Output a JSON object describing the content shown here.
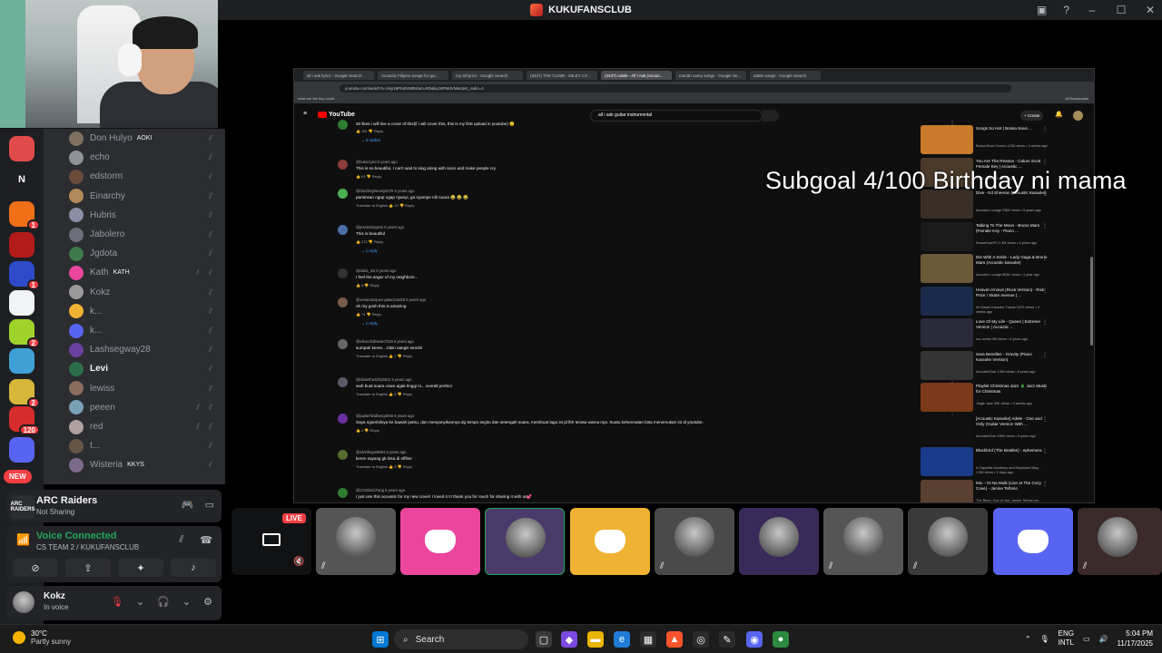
{
  "window": {
    "title": "KUKUFANSCLUB"
  },
  "servers": [
    {
      "badge": "",
      "color": "#e24b4b"
    },
    {
      "badge": "36",
      "color": "#1e1f22",
      "letter": "N"
    },
    {
      "badge": "1",
      "color": "#f0701a"
    },
    {
      "badge": "",
      "color": "#b31b1b"
    },
    {
      "badge": "1",
      "color": "#2f4ac9"
    },
    {
      "badge": "",
      "color": "#f2f3f5"
    },
    {
      "badge": "2",
      "color": "#9fd32b"
    },
    {
      "badge": "",
      "color": "#3fa0d6"
    },
    {
      "badge": "2",
      "color": "#d6b73b"
    },
    {
      "badge": "120",
      "color": "#d62c2c"
    },
    {
      "badge": "",
      "color": "#5865f2"
    }
  ],
  "new_label": "NEW",
  "members": [
    {
      "name": "Don Hulyo",
      "tag": "AOKI",
      "color": "#7f6f5e"
    },
    {
      "name": "echo",
      "tag": "",
      "color": "#8e9297"
    },
    {
      "name": "edstorm",
      "tag": "",
      "color": "#6b4a3a"
    },
    {
      "name": "Einarchy",
      "tag": "",
      "color": "#b08a5a"
    },
    {
      "name": "Hubris",
      "tag": "",
      "color": "#8a8fa6"
    },
    {
      "name": "Jabolero",
      "tag": "",
      "color": "#6d6f78"
    },
    {
      "name": "Jgdota",
      "tag": "",
      "color": "#3e7a4a"
    },
    {
      "name": "Kath",
      "tag": "KATH",
      "color": "#eb459e"
    },
    {
      "name": "Kokz",
      "tag": "",
      "color": "#9a9a9a"
    },
    {
      "name": "k...",
      "tag": "",
      "color": "#f0b232"
    },
    {
      "name": "k...",
      "tag": "",
      "color": "#5865f2"
    },
    {
      "name": "Lashsegway28",
      "tag": "",
      "color": "#6a3fa0"
    },
    {
      "name": "Levi",
      "tag": "",
      "color": "#2c6e49"
    },
    {
      "name": "lewiss",
      "tag": "",
      "color": "#8a6d5a"
    },
    {
      "name": "peeen",
      "tag": "",
      "color": "#7aa0b8"
    },
    {
      "name": "red",
      "tag": "",
      "color": "#b0a0a0"
    },
    {
      "name": "t...",
      "tag": "",
      "color": "#665544"
    },
    {
      "name": "Wisteria",
      "tag": "KKYS",
      "color": "#7c6a8a"
    }
  ],
  "game": {
    "title": "ARC Raiders",
    "status": "Not Sharing",
    "logo": "ARC RAIDERS"
  },
  "voice": {
    "title": "Voice Connected",
    "channel": "CS TEAM 2 / KUKUFANSCLUB"
  },
  "user": {
    "name": "Kokz",
    "status": "In voice"
  },
  "browser": {
    "tabs": [
      "all i ask lyrics - Google Search",
      "Acoustic Filipino songs for gui...",
      "my all lyrics - Google Search",
      "(3437) THE CLIMB - MILEY CY...",
      "(3437) Adele - All I Ask (Acous...",
      "mariah carey songs - Google Se...",
      "adele songs - Google Search"
    ],
    "url": "youtube.com/watch?v=bky18PMdVMBstart=RD&ky18PMdVM&start_radio=1",
    "bookmark": "what are the key contri...",
    "all_bookmarks": "All Bookmarks"
  },
  "youtube": {
    "logo": "YouTube",
    "search": "all i ask guitar instrumental",
    "create": "+ Create"
  },
  "comments": [
    {
      "user": "",
      "text": "20 likes i will live a cover of this(if i will cover this, this is my first upload in youtube) 😊",
      "meta": "👍 181   👎   Reply",
      "replies": "⌄ 3 replies",
      "color": "#2e7d32"
    },
    {
      "user": "@butacryed  5 years ago",
      "text": "This is so beautiful, I can't wait to sing along with soon and make people cry",
      "meta": "👍 61   👎   Reply",
      "replies": "",
      "color": "#8d3b3b"
    },
    {
      "user": "@dazzlingbeauty6276  5 years ago",
      "text": "pantinsan ngap ngap nyanyi, ga nyampe nih suara 😂 😂 😂",
      "meta": "Translate to English    👍 22   👎   Reply",
      "replies": "",
      "color": "#4caf50"
    },
    {
      "user": "@jessieisingess  5 years ago",
      "text": "This is beautiful",
      "meta": "👍 272   👎   Reply",
      "replies": "⌄ 1 reply",
      "color": "#4a6fa5"
    },
    {
      "user": "@daria_osi  6 years ago",
      "text": "I feel the anger of my neighbors...",
      "meta": "👍 5   👎   Reply",
      "replies": "",
      "color": "#333"
    },
    {
      "user": "@vesarvazquez-palacio3488  5 years ago",
      "text": "oh my gosh this is amazing",
      "meta": "👍 71   👎   Reply",
      "replies": "⌄ 1 reply",
      "color": "#7a5a4a"
    },
    {
      "user": "@elsoccfallowan7318  5 years ago",
      "text": "sumpah keren....bikin nangis sendiri",
      "meta": "Translate to English    👍 7   👎   Reply",
      "replies": "",
      "color": "#666"
    },
    {
      "user": "@bkianthwrizky5511  5 years ago",
      "text": "wah buat suara cowo agak tinggi ni... overall perfect",
      "meta": "Translate to English    👍 5   👎   Reply",
      "replies": "",
      "color": "#5a5a6a"
    },
    {
      "user": "@jupiterfieldberg4055  5 years ago",
      "text": "Saya ngambilnya ke bawah justru, dan menyanyikannya dg tempo segitu dan setengah suara, membuat lagu ini jd lbh terasa warna nya. Suatu kehormatan bisa menemukan ini di youtube.",
      "meta": "👍 1   👎   Reply",
      "replies": "",
      "color": "#6a2fa0"
    },
    {
      "user": "@alvinfirgus5553  5 years ago",
      "text": "keren sayang gk bisa di offline",
      "meta": "Translate to English    👍 6   👎   Reply",
      "replies": "",
      "color": "#556b2f"
    },
    {
      "user": "@CristinaCFang  5 years ago",
      "text": "I just use this acoustic for my new cover! I loved it !!! thank you for much for sharing it with us💕",
      "meta": "",
      "replies": "",
      "color": "#2e7d32"
    }
  ],
  "sidebar_videos": [
    {
      "title": "Songs So Hot | Bossa Nova ...",
      "meta": "Bossa Nova Covers  123K views • 2 weeks ago",
      "color": "#c97a2b"
    },
    {
      "title": "You Are The Reason - Calum Scott Female Key | Acoustic ...",
      "meta": "4.8M views • 5 years ago",
      "color": "#4a3a2a"
    },
    {
      "title": "Dive - Ed Sheeran (Acoustic Karaoke)",
      "meta": "Acoustic Lounge  236K views • 5 years ago",
      "color": "#3a2f28"
    },
    {
      "title": "Talking To The Moon - Bruno Mars (Female Key - Piano ...",
      "meta": "KaraoKeysPH  1.3M views • 4 years ago",
      "color": "#1a1a1a"
    },
    {
      "title": "Die With A Smile - Lady Gaga & Bruno Mars (Acoustic karaoke)",
      "meta": "Acoustic Lounge  663K views • 1 year ago",
      "color": "#6b5a3a"
    },
    {
      "title": "Heaven Knows (Rock Version) - Rick Price / Skate Avenue | ...",
      "meta": "MJ Barrio Karaoke Tracks  167K views • 3 weeks ago",
      "color": "#1a2a4a"
    },
    {
      "title": "Love Of My Life - Queen | Extreme Version | Acoustic ...",
      "meta": "acz works  3M views • 6 years ago",
      "color": "#2a2a3a"
    },
    {
      "title": "Sara Bareilles - Gravity (Piano Karaoke Version)",
      "meta": "AcousticClub  2.5M views • 8 years ago",
      "color": "#333"
    },
    {
      "title": "Playlist Christmas Jazz 🎄 Jazz Music for Christmas",
      "meta": "Jingle Jazz  49K views • 4 weeks ago",
      "color": "#7a3a1a"
    },
    {
      "title": "[Acoustic Karaoke] Adele - One and Only (Guitar Version With ...",
      "meta": "AcousticClub  239K views • 5 years ago",
      "color": "#111"
    },
    {
      "title": "Blackbird (The Beatles) - ephemera",
      "meta": "A Cappella Academy and Marylume Mag...  1.3M views • 2 days ago",
      "color": "#1a3a8a"
    },
    {
      "title": "Mix – Di Na Mulit (Live at The Cozy Cove) - Janine Teñoso",
      "meta": "The Band, Cue of Joe, Janine Teñoso an...  Updated today",
      "color": "#5a4030"
    }
  ],
  "overlay": {
    "subgoal": "Subgoal    4/100 Birthday ni mama"
  },
  "tiles": [
    {
      "kind": "live",
      "label": "LIVE"
    },
    {
      "kind": "photo",
      "color": "#555"
    },
    {
      "kind": "discord",
      "color": "#eb459e"
    },
    {
      "kind": "photo",
      "color": "#4a3a6a"
    },
    {
      "kind": "discord",
      "color": "#f0b232"
    },
    {
      "kind": "photo",
      "color": "#4a4a4a"
    },
    {
      "kind": "photo",
      "color": "#3a2a5a"
    },
    {
      "kind": "photo",
      "color": "#555"
    },
    {
      "kind": "photo",
      "color": "#3a3a3a"
    },
    {
      "kind": "discord",
      "color": "#5865f2"
    },
    {
      "kind": "photo",
      "color": "#3a2a2a"
    }
  ],
  "taskbar": {
    "temp": "30°C",
    "weather": "Partly sunny",
    "search": "Search",
    "lang1": "ENG",
    "lang2": "INTL",
    "time": "5:04 PM",
    "date": "11/17/2025"
  }
}
